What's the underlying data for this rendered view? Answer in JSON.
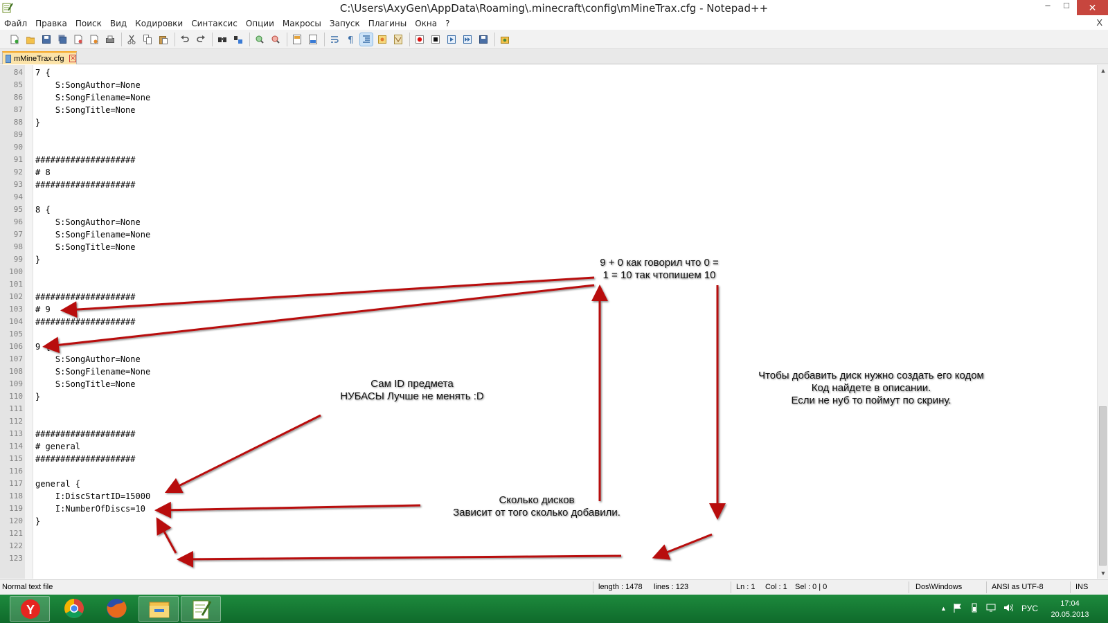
{
  "window": {
    "title": "C:\\Users\\AxyGen\\AppData\\Roaming\\.minecraft\\config\\mMineTrax.cfg - Notepad++",
    "minimize": "–",
    "maximize": "□",
    "close": "✕"
  },
  "menu": {
    "items": [
      "Файл",
      "Правка",
      "Поиск",
      "Вид",
      "Кодировки",
      "Синтаксис",
      "Опции",
      "Макросы",
      "Запуск",
      "Плагины",
      "Окна",
      "?"
    ],
    "close_doc": "X"
  },
  "toolbar": {
    "icons": [
      "new-file-icon",
      "open-file-icon",
      "save-icon",
      "save-all-icon",
      "close-icon",
      "close-all-icon",
      "print-icon",
      "cut-icon",
      "copy-icon",
      "paste-icon",
      "undo-icon",
      "redo-icon",
      "find-icon",
      "replace-icon",
      "zoom-in-icon",
      "zoom-out-icon",
      "sync-vertical-icon",
      "sync-horizontal-icon",
      "word-wrap-icon",
      "show-all-chars-icon",
      "indent-guide-icon",
      "user-lang-icon",
      "doc-map-icon",
      "record-macro-icon",
      "stop-record-icon",
      "play-macro-icon",
      "run-macro-multiple-icon",
      "save-macro-icon",
      "run-icon"
    ]
  },
  "tab": {
    "label": "mMineTrax.cfg"
  },
  "editor": {
    "lines": [
      {
        "n": "84",
        "t": "7 {"
      },
      {
        "n": "85",
        "t": "    S:SongAuthor=None"
      },
      {
        "n": "86",
        "t": "    S:SongFilename=None"
      },
      {
        "n": "87",
        "t": "    S:SongTitle=None"
      },
      {
        "n": "88",
        "t": "}"
      },
      {
        "n": "89",
        "t": ""
      },
      {
        "n": "90",
        "t": ""
      },
      {
        "n": "91",
        "t": "####################"
      },
      {
        "n": "92",
        "t": "# 8"
      },
      {
        "n": "93",
        "t": "####################"
      },
      {
        "n": "94",
        "t": ""
      },
      {
        "n": "95",
        "t": "8 {"
      },
      {
        "n": "96",
        "t": "    S:SongAuthor=None"
      },
      {
        "n": "97",
        "t": "    S:SongFilename=None"
      },
      {
        "n": "98",
        "t": "    S:SongTitle=None"
      },
      {
        "n": "99",
        "t": "}"
      },
      {
        "n": "100",
        "t": ""
      },
      {
        "n": "101",
        "t": ""
      },
      {
        "n": "102",
        "t": "####################"
      },
      {
        "n": "103",
        "t": "# 9"
      },
      {
        "n": "104",
        "t": "####################"
      },
      {
        "n": "105",
        "t": ""
      },
      {
        "n": "106",
        "t": "9 {"
      },
      {
        "n": "107",
        "t": "    S:SongAuthor=None"
      },
      {
        "n": "108",
        "t": "    S:SongFilename=None"
      },
      {
        "n": "109",
        "t": "    S:SongTitle=None"
      },
      {
        "n": "110",
        "t": "}"
      },
      {
        "n": "111",
        "t": ""
      },
      {
        "n": "112",
        "t": ""
      },
      {
        "n": "113",
        "t": "####################"
      },
      {
        "n": "114",
        "t": "# general"
      },
      {
        "n": "115",
        "t": "####################"
      },
      {
        "n": "116",
        "t": ""
      },
      {
        "n": "117",
        "t": "general {"
      },
      {
        "n": "118",
        "t": "    I:DiscStartID=15000"
      },
      {
        "n": "119",
        "t": "    I:NumberOfDiscs=10"
      },
      {
        "n": "120",
        "t": "}"
      },
      {
        "n": "121",
        "t": ""
      },
      {
        "n": "122",
        "t": ""
      },
      {
        "n": "123",
        "t": ""
      }
    ]
  },
  "status": {
    "file_type": "Normal text file",
    "length": "length : 1478",
    "lines": "lines : 123",
    "ln": "Ln : 1",
    "col": "Col : 1",
    "sel": "Sel : 0 | 0",
    "eol": "Dos\\Windows",
    "encoding": "ANSI as UTF-8",
    "mode": "INS"
  },
  "taskbar": {
    "apps": [
      "yandex-browser-icon",
      "chrome-icon",
      "firefox-icon",
      "file-explorer-icon",
      "notepad-plus-plus-icon"
    ],
    "lang": "РУС",
    "time": "17:04",
    "date": "20.05.2013"
  },
  "annotations": {
    "top_right": [
      "9 + 0 как говорил что 0 =",
      "1 = 10 так чтопишем 10"
    ],
    "id_note": [
      "Сам ID предмета",
      "НУБАСЫ Лучше не менять :D"
    ],
    "discs_note": [
      "Сколько дисков",
      "Зависит от того сколько добавили."
    ],
    "howto_note": [
      "Чтобы добавить диск нужно создать его кодом",
      "Код найдете в описании.",
      "Если не нуб то поймут по скрину."
    ],
    "arrow_color": "#b81010"
  }
}
